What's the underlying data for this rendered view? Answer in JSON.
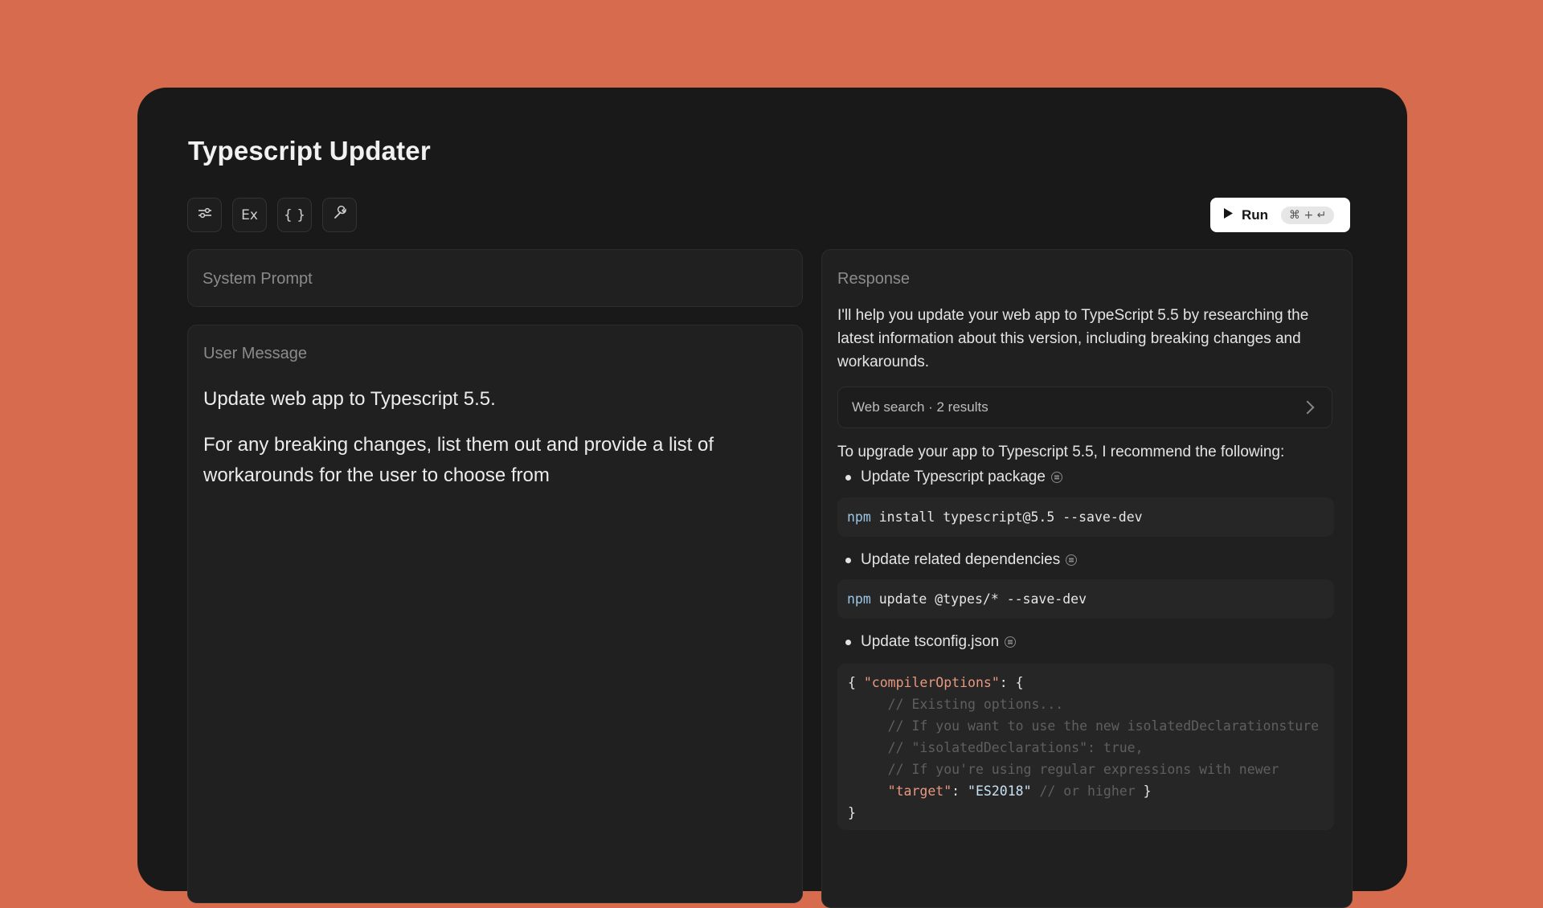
{
  "app": {
    "title": "Typescript Updater"
  },
  "toolbar": {
    "buttons": [
      {
        "icon": "sliders-icon"
      },
      {
        "label": "Ex"
      },
      {
        "label": "{ }"
      },
      {
        "icon": "wrench-icon"
      }
    ],
    "run": {
      "label": "Run",
      "shortcut": "⌘ + ↵"
    }
  },
  "system_prompt": {
    "label": "System Prompt"
  },
  "user_message": {
    "label": "User Message",
    "paragraphs": [
      "Update web app to Typescript 5.5.",
      "For any breaking changes, list them out and provide a list of workarounds for the user to choose from"
    ]
  },
  "response": {
    "label": "Response",
    "intro": "I'll help you update your web app to TypeScript 5.5 by researching the latest information about this version, including breaking changes and workarounds.",
    "web_search": "Web search · 2 results",
    "recommend": "To upgrade your app to Typescript 5.5, I recommend the following:",
    "steps": [
      {
        "title": "Update Typescript package",
        "cmd_keyword": "npm",
        "cmd_rest": " install typescript@5.5 --save-dev"
      },
      {
        "title": "Update related dependencies",
        "cmd_keyword": "npm",
        "cmd_rest": " update @types/* --save-dev"
      },
      {
        "title": "Update tsconfig.json"
      }
    ],
    "tsconfig": {
      "open_brace": "{ ",
      "key": "\"compilerOptions\"",
      "after_key": ": {",
      "comment1": "// Existing options...",
      "comment2": "// If you want to use the new isolatedDeclarationsture",
      "comment3": "// \"isolatedDeclarations\": true,",
      "comment4": "// If you're using regular expressions with newer",
      "target_key": "\"target\"",
      "colon": ": ",
      "target_val": "\"ES2018\"",
      "target_comment": " // or higher",
      "end_inner": " }",
      "close": "}"
    }
  }
}
